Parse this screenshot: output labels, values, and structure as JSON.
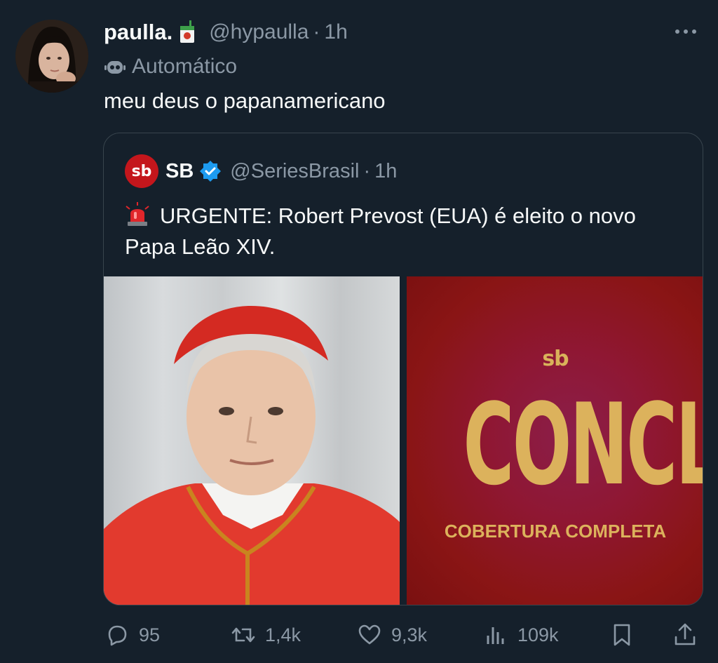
{
  "tweet": {
    "author": {
      "name": "paulla.",
      "handle": "@hypaulla",
      "separator": "·",
      "time": "1h",
      "avatar_icon": "profile-photo",
      "name_emoji_icon": "juice-box-icon"
    },
    "automated_label": "Automático",
    "text": "meu deus o papanamericano",
    "more_icon": "ellipsis-icon"
  },
  "quote": {
    "logo_text": "sb",
    "name": "SB",
    "handle": "@SeriesBrasil",
    "separator": "·",
    "time": "1h",
    "verified_color": "#1d9bf0",
    "text": "URGENTE: Robert Prevost (EUA) é eleito o novo Papa Leão XIV.",
    "text_icon": "police-siren-icon",
    "media": {
      "left_image": "cardinal-portrait",
      "right_logo": "sb",
      "right_title": "CONCLAVE",
      "right_subtitle": "COBERTURA COMPLETA"
    }
  },
  "actions": {
    "reply_count": "95",
    "retweet_count": "1,4k",
    "like_count": "9,3k",
    "views_count": "109k"
  },
  "colors": {
    "background": "#15202b",
    "text": "#f7f9f9",
    "secondary": "#8b98a5",
    "border": "#38444d",
    "brand_red": "#c4161c",
    "gold": "#dcb25c"
  }
}
